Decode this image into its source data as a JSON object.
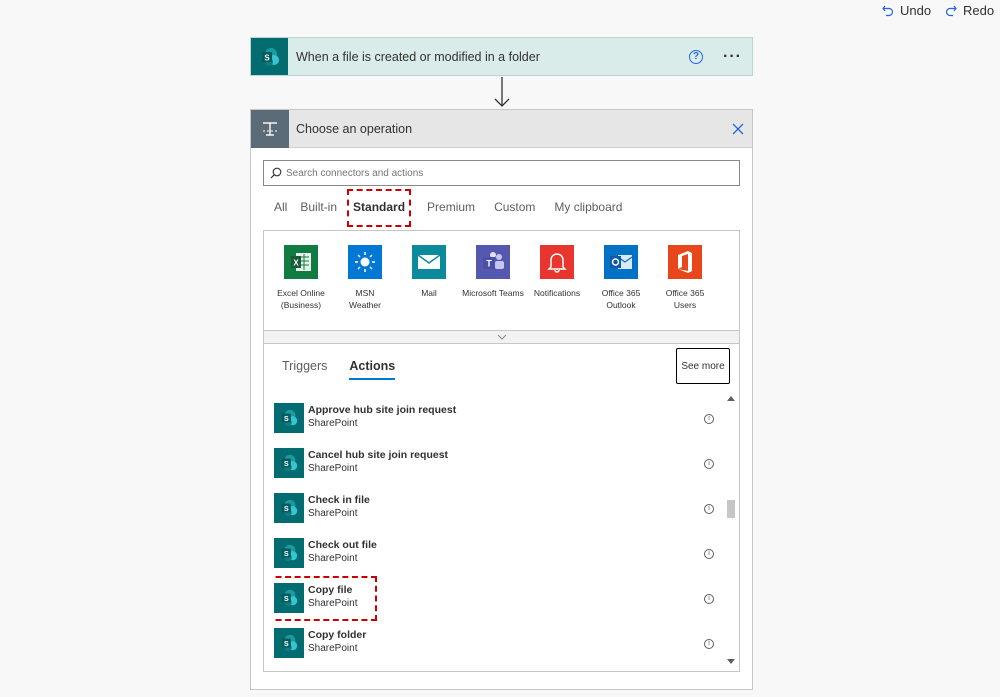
{
  "toolbar": {
    "undo_label": "Undo",
    "redo_label": "Redo"
  },
  "trigger": {
    "title": "When a file is created or modified in a folder",
    "help": "?",
    "more": "···"
  },
  "panel": {
    "title": "Choose an operation",
    "search_placeholder": "Search connectors and actions",
    "filter_tabs": [
      "All",
      "Built-in",
      "Standard",
      "Premium",
      "Custom",
      "My clipboard"
    ],
    "active_filter": "Standard",
    "connectors": [
      {
        "label": "Excel Online (Business)",
        "icon": "excel-icon",
        "color": "#107c41"
      },
      {
        "label": "MSN Weather",
        "icon": "weather-icon",
        "color": "#0078d4"
      },
      {
        "label": "Mail",
        "icon": "mail-icon",
        "color": "#0a8a9c"
      },
      {
        "label": "Microsoft Teams",
        "icon": "teams-icon",
        "color": "#5558af"
      },
      {
        "label": "Notifications",
        "icon": "bell-icon",
        "color": "#e8362e"
      },
      {
        "label": "Office 365 Outlook",
        "icon": "outlook-icon",
        "color": "#0072c6"
      },
      {
        "label": "Office 365 Users",
        "icon": "office-icon",
        "color": "#e8461b"
      }
    ],
    "type_tabs": [
      "Triggers",
      "Actions"
    ],
    "active_type": "Actions",
    "see_more": "See more",
    "actions": [
      {
        "name": "Approve hub site join request",
        "connector": "SharePoint"
      },
      {
        "name": "Cancel hub site join request",
        "connector": "SharePoint"
      },
      {
        "name": "Check in file",
        "connector": "SharePoint"
      },
      {
        "name": "Check out file",
        "connector": "SharePoint"
      },
      {
        "name": "Copy file",
        "connector": "SharePoint"
      },
      {
        "name": "Copy folder",
        "connector": "SharePoint"
      }
    ]
  },
  "colors": {
    "sharepoint": "#036c70",
    "highlight": "#cc0000",
    "accent": "#0078d4"
  }
}
